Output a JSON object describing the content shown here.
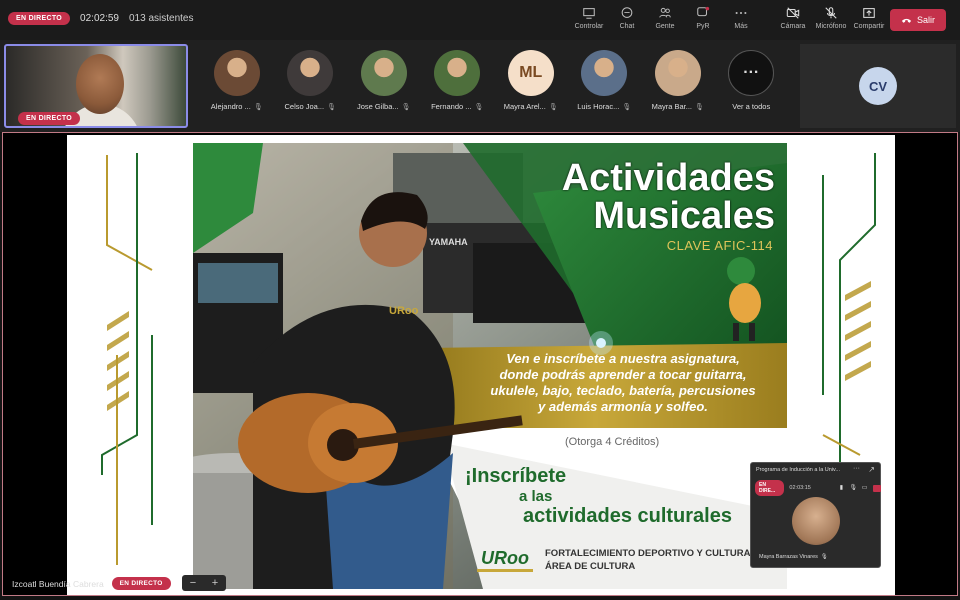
{
  "header": {
    "live_label": "EN DIRECTO",
    "timer": "02:02:59",
    "attendees": "013 asistentes",
    "toolbar": [
      {
        "label": "Controlar",
        "icon": "screen-share-icon"
      },
      {
        "label": "Chat",
        "icon": "chat-icon"
      },
      {
        "label": "Gente",
        "icon": "people-icon"
      },
      {
        "label": "PyR",
        "icon": "qa-icon"
      },
      {
        "label": "Más",
        "icon": "more-icon"
      },
      {
        "label": "Cámara",
        "icon": "camera-off-icon"
      },
      {
        "label": "Micrófono",
        "icon": "mic-off-icon"
      },
      {
        "label": "Compartir",
        "icon": "share-icon"
      }
    ],
    "leave_label": "Salir"
  },
  "self_tile": {
    "live_label": "EN DIRECTO"
  },
  "participants": [
    {
      "name": "Alejandro ...",
      "initials": "",
      "color": "#6b4a35"
    },
    {
      "name": "Celso Joa...",
      "initials": "",
      "color": "#3f3a3a"
    },
    {
      "name": "Jose Gilba...",
      "initials": "",
      "color": "#5f7a4e"
    },
    {
      "name": "Fernando ...",
      "initials": "",
      "color": "#4e6f3c"
    },
    {
      "name": "Mayra Arel...",
      "initials": "ML",
      "color": "#f5dfc9"
    },
    {
      "name": "Luis Horac...",
      "initials": "",
      "color": "#5b6f8a"
    },
    {
      "name": "Mayra Bar...",
      "initials": "",
      "color": "#c9a98a"
    },
    {
      "name": "Ver a todos",
      "initials": "···",
      "color": "#111111"
    }
  ],
  "overflow_tile": {
    "initials": "CV"
  },
  "poster": {
    "title1": "Actividades",
    "title2": "Musicales",
    "code": "CLAVE AFIC-114",
    "desc": [
      "Ven e inscríbete a nuestra asignatura,",
      "donde podrás  aprender a tocar guitarra,",
      "ukulele, bajo, teclado, batería, percusiones",
      "y además armonía y solfeo."
    ],
    "credits": "(Otorga 4 Créditos)",
    "cta1": "¡Inscríbete",
    "cta2": "a las",
    "cta3": "actividades culturales",
    "logo": "URoo",
    "footer1": "FORTALECIMIENTO DEPORTIVO Y CULTURAL",
    "footer2": "ÁREA DE CULTURA",
    "keyboard_brand": "YAMAHA",
    "shirt_logo": "URoo"
  },
  "pip": {
    "title": "Programa de Inducción a la Univ...",
    "live_label": "EN DIRE...",
    "time": "02:03:15",
    "name": "Mayra Barrazas Vinares"
  },
  "presenter": {
    "name": "Izcoatl Buendía Cabrera",
    "live_label": "EN DIRECTO",
    "zoom_out": "−",
    "zoom_in": "+"
  },
  "colors": {
    "live": "#c4314b",
    "accent": "#8b8ce8",
    "green": "#1f6b2c",
    "gold": "#b99a2f"
  }
}
